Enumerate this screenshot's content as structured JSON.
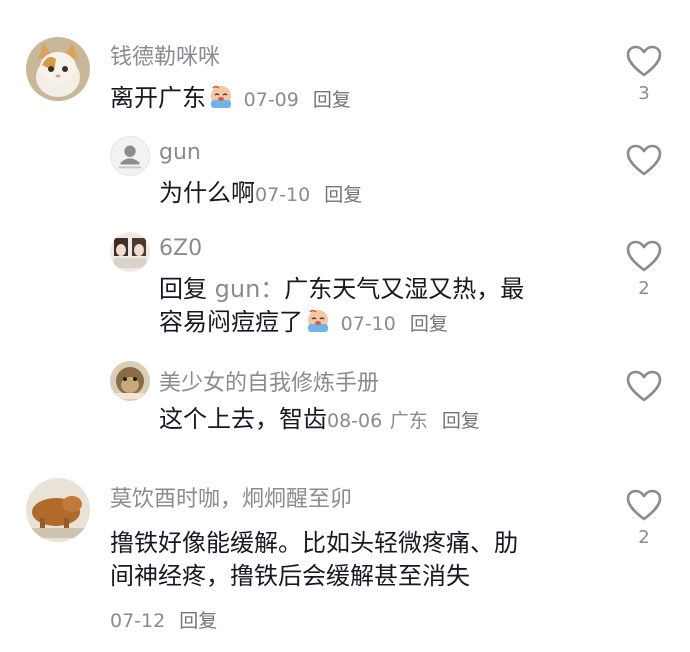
{
  "comments": [
    {
      "username": "钱德勒咪咪",
      "text": "离开广东",
      "emoji": "crying-face-emoji",
      "date": "07-09",
      "reply_label": "回复",
      "likes": "3",
      "avatar": "cat-avatar"
    },
    {
      "username": "gun",
      "text": "为什么啊",
      "date": "07-10",
      "reply_label": "回复",
      "likes": "",
      "avatar": "default-user-avatar"
    },
    {
      "username": "6Z0",
      "reply_prefix": "回复",
      "reply_target": "gun：",
      "text_line1": "广东天气又湿又热，最",
      "text_line2": "容易闷痘痘了",
      "emoji": "crying-face-emoji",
      "date": "07-10",
      "reply_label": "回复",
      "likes": "2",
      "avatar": "anime-avatar"
    },
    {
      "username": "美少女的自我修炼手册",
      "text": "这个上去，智齿",
      "date": "08-06",
      "location": "广东",
      "reply_label": "回复",
      "likes": "",
      "avatar": "monkey-avatar"
    },
    {
      "username": "莫饮酉时咖，炯炯醒至卯",
      "text_line1": "撸铁好像能缓解。比如头轻微疼痛、肋",
      "text_line2": "间神经疼，撸铁后会缓解甚至消失",
      "date": "07-12",
      "reply_label": "回复",
      "likes": "2",
      "avatar": "dog-avatar"
    }
  ],
  "colors": {
    "text_primary": "#161823",
    "text_secondary": "#8a8b91",
    "heart_outline": "#8a8b91"
  },
  "icons": {
    "like": "heart-outline-icon"
  }
}
